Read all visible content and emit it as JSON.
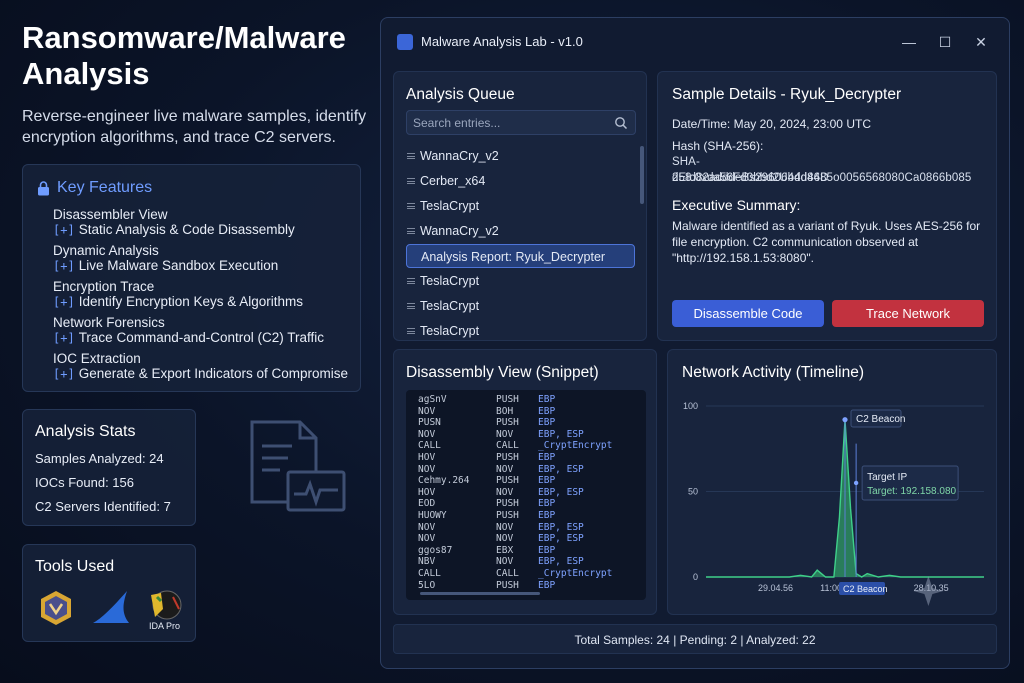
{
  "hero": {
    "title": "Ransomware/Malware Analysis",
    "subtitle": "Reverse-engineer live malware samples, identify encryption algorithms, and trace C2 servers."
  },
  "features": {
    "heading": "Key Features",
    "bracket": "[+]",
    "items": [
      {
        "title": "Disassembler View",
        "desc": "Static Analysis & Code Disassembly"
      },
      {
        "title": "Dynamic Analysis",
        "desc": "Live Malware Sandbox Execution"
      },
      {
        "title": "Encryption Trace",
        "desc": "Identify Encryption Keys & Algorithms"
      },
      {
        "title": "Network Forensics",
        "desc": "Trace Command-and-Control (C2) Traffic"
      },
      {
        "title": "IOC Extraction",
        "desc": "Generate & Export Indicators of Compromise"
      }
    ]
  },
  "stats": {
    "heading": "Analysis Stats",
    "rows": [
      "Samples Analyzed: 24",
      "IOCs Found: 156",
      "C2 Servers Identified: 7"
    ]
  },
  "tools": {
    "heading": "Tools Used",
    "ida_label": "IDA Pro"
  },
  "window": {
    "title": "Malware Analysis Lab - v1.0",
    "min": "—",
    "max": "☐",
    "close": "✕"
  },
  "queue": {
    "title": "Analysis Queue",
    "search_placeholder": "Search entries...",
    "items": [
      {
        "label": "WannaCry_v2",
        "selected": false
      },
      {
        "label": "Cerber_x64",
        "selected": false
      },
      {
        "label": "TeslaCrypt",
        "selected": false
      },
      {
        "label": "WannaCry_v2",
        "selected": false
      },
      {
        "label": "Analysis Report: Ryuk_Decrypter",
        "selected": true
      },
      {
        "label": "TeslaCrypt",
        "selected": false
      },
      {
        "label": "TeslaCrypt",
        "selected": false
      },
      {
        "label": "TeslaCrypt",
        "selected": false
      }
    ]
  },
  "details": {
    "title": "Sample Details - Ryuk_Decrypter",
    "datetime": "Date/Time: May 20, 2024, 23:00 UTC",
    "hash_label": "Hash (SHA-256):",
    "hash_line1": "SHA-258:0xda56Fd0bbd2U4dd4485o0056568080Ca0866b085",
    "hash_line2": "dEId82adddeBs29606b4d86D",
    "summary_heading": "Executive Summary:",
    "summary_line1": "Malware identified as a variant of Ryuk. Uses AES-256 for",
    "summary_line2": "file encryption. C2 communication observed at",
    "summary_line3": "\"http://192.158.1.53:8080\".",
    "btn_disassemble": "Disassemble Code",
    "btn_trace": "Trace Network"
  },
  "disasm": {
    "title": "Disassembly View (Snippet)",
    "rows": [
      [
        "agSnV",
        "PUSH",
        "EBP"
      ],
      [
        "NOV",
        "BOH",
        "EBP"
      ],
      [
        "PUSN",
        "PUSH",
        "EBP"
      ],
      [
        "NOV",
        "NOV",
        "EBP, ESP"
      ],
      [
        "CALL",
        "CALL",
        "_CryptEncrypt"
      ],
      [
        "HOV",
        "PUSH",
        "EBP"
      ],
      [
        "NOV",
        "NOV",
        "EBP, ESP"
      ],
      [
        "Cehmy.264",
        "PUSH",
        "EBP"
      ],
      [
        "HOV",
        "NOV",
        "EBP, ESP"
      ],
      [
        "EOD",
        "PUSH",
        "EBP"
      ],
      [
        "HUOWY",
        "PUSH",
        "EBP"
      ],
      [
        "NOV",
        "NOV",
        "EBP, ESP"
      ],
      [
        "NOV",
        "NOV",
        "EBP, ESP"
      ],
      [
        "ggos87",
        "EBX",
        "EBP"
      ],
      [
        "NBV",
        "NOV",
        "EBP, ESP"
      ],
      [
        "CALL",
        "CALL",
        "_CryptEncrypt"
      ],
      [
        "5LO",
        "PUSH",
        "EBP"
      ]
    ]
  },
  "network": {
    "title": "Network Activity (Timeline)",
    "tooltip_beacon": "C2 Beacon",
    "tooltip_target_title": "Target IP",
    "tooltip_target_value": "Target: 192.158.080",
    "bottom_badge": "C2 Beacon"
  },
  "chart_data": {
    "type": "area",
    "title": "Network Activity (Timeline)",
    "ylim": [
      0,
      100
    ],
    "yticks": [
      0,
      50,
      100
    ],
    "xtick_labels": [
      "29.04.56",
      "11:00",
      "28.10.35"
    ],
    "x": [
      0,
      10,
      20,
      30,
      34,
      38,
      40,
      43,
      46,
      48,
      50,
      52,
      54,
      56,
      58,
      62,
      66,
      70,
      80,
      90,
      100
    ],
    "values": [
      0,
      0,
      0,
      0,
      1,
      0,
      4,
      0,
      0,
      35,
      92,
      40,
      2,
      0,
      2,
      0,
      1,
      0,
      0,
      0,
      0
    ],
    "colors": {
      "line": "#3fd08a",
      "fill": "#2f9b66"
    }
  },
  "footer": {
    "status": "Total Samples: 24 | Pending: 2 | Analyzed: 22"
  }
}
